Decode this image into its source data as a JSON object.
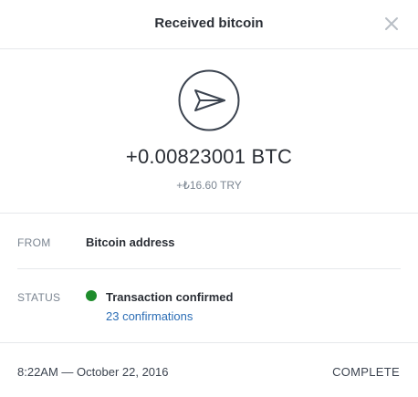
{
  "dialog": {
    "title": "Received bitcoin",
    "close_icon": "close-icon"
  },
  "transaction": {
    "icon": "paper-plane-icon",
    "amount": "+0.00823001 BTC",
    "fiat_amount": "+₺16.60 TRY"
  },
  "details": {
    "from_label": "FROM",
    "from_value": "Bitcoin address",
    "status_label": "STATUS",
    "status_value": "Transaction confirmed",
    "confirmations": "23 confirmations",
    "status_color": "#1e8c2c"
  },
  "footer": {
    "timestamp": "8:22AM — October 22, 2016",
    "state": "COMPLETE"
  },
  "colors": {
    "link": "#2b6db5",
    "text_primary": "#2b2f36",
    "text_muted": "#7b8591"
  }
}
